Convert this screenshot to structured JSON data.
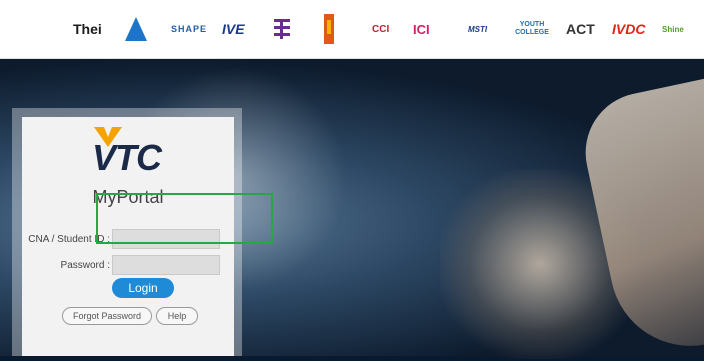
{
  "brand": {
    "title": "MyPortal"
  },
  "partners": [
    "Thei",
    "PEAK",
    "SHAPE",
    "IVE",
    "HKDI",
    "ICI",
    "CCI",
    "ICI",
    "MSTI",
    "YOUTH COLLEGE",
    "ACT",
    "IVDC",
    "Shine"
  ],
  "login": {
    "cna_label": "CNA / Student ID :",
    "password_label": "Password :",
    "cna_value": "",
    "password_value": "",
    "login_label": "Login",
    "forgot_label": "Forgot Password",
    "help_label": "Help"
  },
  "colors": {
    "accent": "#1f8ad6",
    "highlight": "#28a745"
  }
}
